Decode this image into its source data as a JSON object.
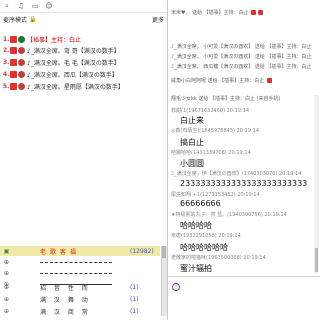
{
  "toolbar": {
    "icons": [
      "search-icon",
      "speaker-icon",
      "window-icon",
      "user-icon"
    ]
  },
  "mode": {
    "label": "麦序模式",
    "settings": "更多"
  },
  "mic_list": [
    {
      "num": "1.",
      "text": "【插事】主持：白止",
      "red": true
    },
    {
      "num": "2.",
      "text": "♪_满汉全席。弯  哥【满汉の数手】",
      "red": false
    },
    {
      "num": "3.",
      "text": "♪_满汉全席。毛  毛【满汉の数手】",
      "red": false
    },
    {
      "num": "4.",
      "text": "♪_满汉全席。西瓜【满汉の数手】",
      "red": false
    },
    {
      "num": "5.",
      "text": "♪_满汉全席。星雨愿【满汉の数手】",
      "red": false
    }
  ],
  "rooms": [
    {
      "name": "老歌客福",
      "count": "(12982)",
      "main": true
    },
    {
      "name": "",
      "count": ""
    },
    {
      "name": "",
      "count": ""
    },
    {
      "name": "",
      "count": ""
    },
    {
      "name": "招  音  性  而",
      "count": "(1)"
    },
    {
      "name": "满  汉  舞  动",
      "count": "(1)"
    },
    {
      "name": "满  汉  商  常",
      "count": "(1)"
    }
  ],
  "chat": {
    "lines": [
      "米米♥。 送给 【插事】主持：白止",
      "♪_满汉全席。 小可爱【满汉の酉欢】 送给 【插事】主持：白止",
      "♪_满汉全席。 小可爱【满汉の酉欢】 送给 【插事】主持：白止",
      "♪_满汉全席。 西瓜糖【满汉の酉欢】 送给 【插事】主持：白止",
      "威角小白阿阿呢 送给 【插事】主持：白止",
      "翔毛少女kk 送给 【插事】主持：白止   (来自手机)"
    ],
    "messages": [
      {
        "head": "菲甜(1(19671632460) 20:19:14",
        "body": "白止来"
      },
      {
        "head": "◎鑫(鸡陌生)(1845978845) 20:19:14",
        "body": "搞白止"
      },
      {
        "head": "哈娜哈哈(1431339708) 20:19:14",
        "body": "小圆圆"
      },
      {
        "head": "♪_满汉全席。伊【满汉の酉欢】(1740303076) 20:19:14",
        "body": "2333333333333333333333333"
      },
      {
        "head": "尾生知翔  +1(1273153452) 20:19:14",
        "body": "66666666"
      },
      {
        "head": "★特极累的丸子。茶  蓝。(1940390756) 20:19:14",
        "body": "哈哈哈哈"
      },
      {
        "head": "亲唐(1932291058) 20:19:14",
        "body": "哈哈哈哈哈哈"
      },
      {
        "head": "老散家的啦猫咪(1963500068) 20:19:14",
        "body": "蜜汁辐拍"
      }
    ]
  }
}
